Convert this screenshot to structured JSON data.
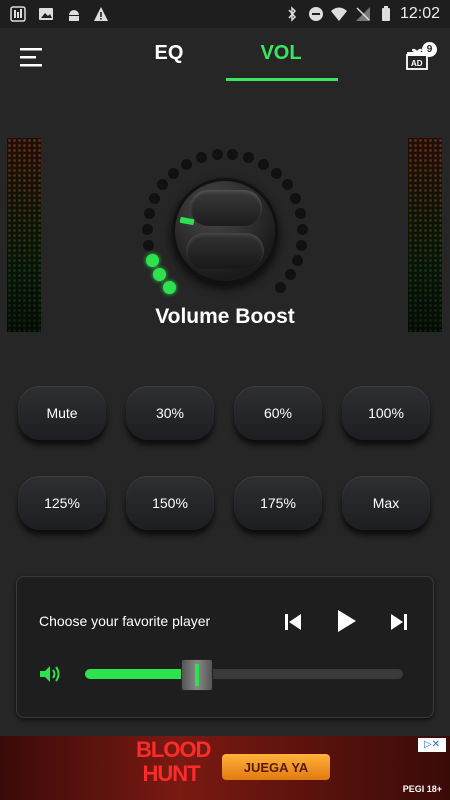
{
  "status_bar": {
    "time": "12:02"
  },
  "tabs": [
    {
      "label": "EQ"
    },
    {
      "label": "VOL"
    }
  ],
  "header": {
    "ad_badge_count": "9",
    "ad_badge_label": "AD"
  },
  "knob": {
    "active_dots": 3,
    "total_dots": 24
  },
  "title": "Volume Boost",
  "presets": [
    {
      "label": "Mute"
    },
    {
      "label": "30%"
    },
    {
      "label": "60%"
    },
    {
      "label": "100%"
    },
    {
      "label": "125%"
    },
    {
      "label": "150%"
    },
    {
      "label": "175%"
    },
    {
      "label": "Max"
    }
  ],
  "player": {
    "label": "Choose your favorite player",
    "volume_fraction": 0.35
  },
  "ad": {
    "title": "BLOOD HUNT",
    "cta": "JUEGA YA",
    "rating": "PEGI 18+"
  },
  "colors": {
    "accent": "#2ee24f",
    "background": "#262626"
  }
}
